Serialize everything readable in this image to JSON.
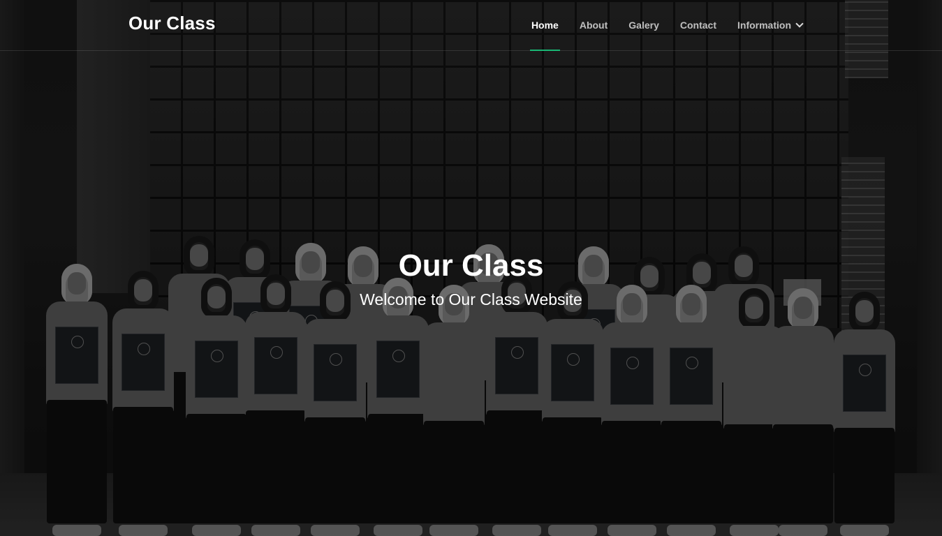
{
  "navbar": {
    "brand": "Our Class",
    "items": [
      {
        "label": "Home",
        "active": true
      },
      {
        "label": "About",
        "active": false
      },
      {
        "label": "Galery",
        "active": false
      },
      {
        "label": "Contact",
        "active": false
      },
      {
        "label": "Information",
        "active": false,
        "has_dropdown": true,
        "icon": "chevron-down-icon"
      }
    ],
    "active_indicator_color": "#19b774"
  },
  "hero": {
    "title": "Our Class",
    "subtitle": "Welcome to Our Class Website",
    "background_image": "class-group-photo"
  }
}
